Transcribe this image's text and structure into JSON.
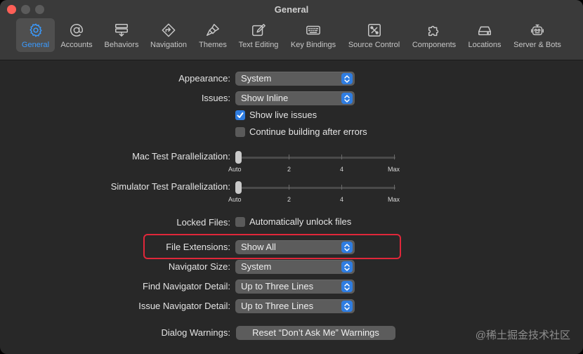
{
  "window": {
    "title": "General"
  },
  "tabs": [
    {
      "label": "General",
      "icon": "gear-icon"
    },
    {
      "label": "Accounts",
      "icon": "at-sign-icon"
    },
    {
      "label": "Behaviors",
      "icon": "behaviors-icon"
    },
    {
      "label": "Navigation",
      "icon": "navigation-icon"
    },
    {
      "label": "Themes",
      "icon": "brush-icon"
    },
    {
      "label": "Text Editing",
      "icon": "pencil-square-icon"
    },
    {
      "label": "Key Bindings",
      "icon": "keyboard-icon"
    },
    {
      "label": "Source Control",
      "icon": "source-control-icon"
    },
    {
      "label": "Components",
      "icon": "puzzle-icon"
    },
    {
      "label": "Locations",
      "icon": "drive-icon"
    },
    {
      "label": "Server & Bots",
      "icon": "robot-icon"
    }
  ],
  "settings": {
    "appearance": {
      "label": "Appearance:",
      "value": "System"
    },
    "issues": {
      "label": "Issues:",
      "value": "Show Inline"
    },
    "show_live_issues": {
      "label": "Show live issues",
      "checked": true
    },
    "continue_building": {
      "label": "Continue building after errors",
      "checked": false
    },
    "mac_test": {
      "label": "Mac Test Parallelization:",
      "ticks": [
        "Auto",
        "2",
        "4",
        "Max"
      ],
      "value": "Auto"
    },
    "sim_test": {
      "label": "Simulator Test Parallelization:",
      "ticks": [
        "Auto",
        "2",
        "4",
        "Max"
      ],
      "value": "Auto"
    },
    "locked_files": {
      "label": "Locked Files:",
      "checkbox_label": "Automatically unlock files",
      "checked": false
    },
    "file_extensions": {
      "label": "File Extensions:",
      "value": "Show All"
    },
    "navigator_size": {
      "label": "Navigator Size:",
      "value": "System"
    },
    "find_navigator_detail": {
      "label": "Find Navigator Detail:",
      "value": "Up to Three Lines"
    },
    "issue_navigator_detail": {
      "label": "Issue Navigator Detail:",
      "value": "Up to Three Lines"
    },
    "dialog_warnings": {
      "label": "Dialog Warnings:",
      "button": "Reset “Don’t Ask Me” Warnings"
    }
  },
  "watermark": "@稀土掘金技术社区",
  "colors": {
    "accent": "#2f7de1",
    "highlight": "#e0273a"
  }
}
